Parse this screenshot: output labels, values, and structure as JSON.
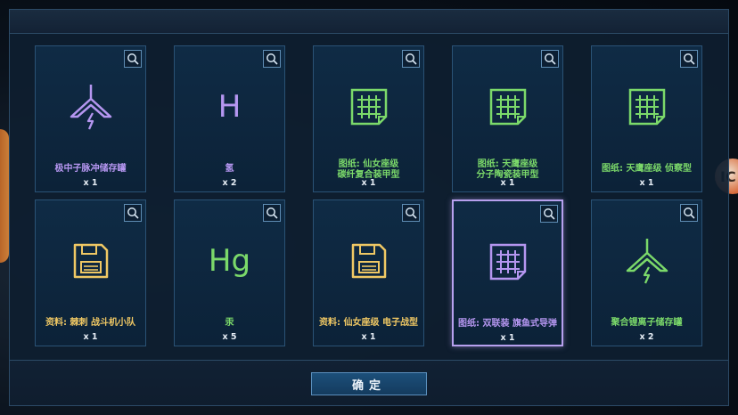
{
  "colors": {
    "purple": "#b596f0",
    "green": "#7bd96a",
    "yellow": "#f0c864",
    "white": "#e6edf5"
  },
  "orb_text": "IC",
  "cards": [
    {
      "name": "极中子脉冲储存罐",
      "qty": "x 1",
      "icon": "storage-tank-icon",
      "color": "#b596f0"
    },
    {
      "name": "氢",
      "qty": "x 2",
      "icon": "element-symbol",
      "symbol": "H",
      "color": "#b596f0"
    },
    {
      "name_lines": [
        "图纸: 仙女座级",
        "碳纤复合装甲型"
      ],
      "qty": "x 1",
      "icon": "blueprint-icon",
      "color": "#7bd96a"
    },
    {
      "name_lines": [
        "图纸: 天鹰座级",
        "分子陶瓷装甲型"
      ],
      "qty": "x 1",
      "icon": "blueprint-icon",
      "color": "#7bd96a"
    },
    {
      "name": "图纸: 天鹰座级 侦察型",
      "qty": "x 1",
      "icon": "blueprint-icon",
      "color": "#7bd96a"
    },
    {
      "name": "资料: 棘刺 战斗机小队",
      "qty": "x 1",
      "icon": "floppy-disk-icon",
      "color": "#f0c864"
    },
    {
      "name": "汞",
      "qty": "x 5",
      "icon": "element-symbol",
      "symbol": "Hg",
      "color": "#7bd96a"
    },
    {
      "name": "资料: 仙女座级 电子战型",
      "qty": "x 1",
      "icon": "floppy-disk-icon",
      "color": "#f0c864"
    },
    {
      "name": "图纸: 双联装 旗鱼式导弹",
      "qty": "x 1",
      "icon": "blueprint-icon",
      "color": "#b596f0",
      "selected": true
    },
    {
      "name": "聚合锂离子储存罐",
      "qty": "x 2",
      "icon": "storage-tank-icon",
      "color": "#7bd96a"
    }
  ],
  "confirm_label": "确定"
}
